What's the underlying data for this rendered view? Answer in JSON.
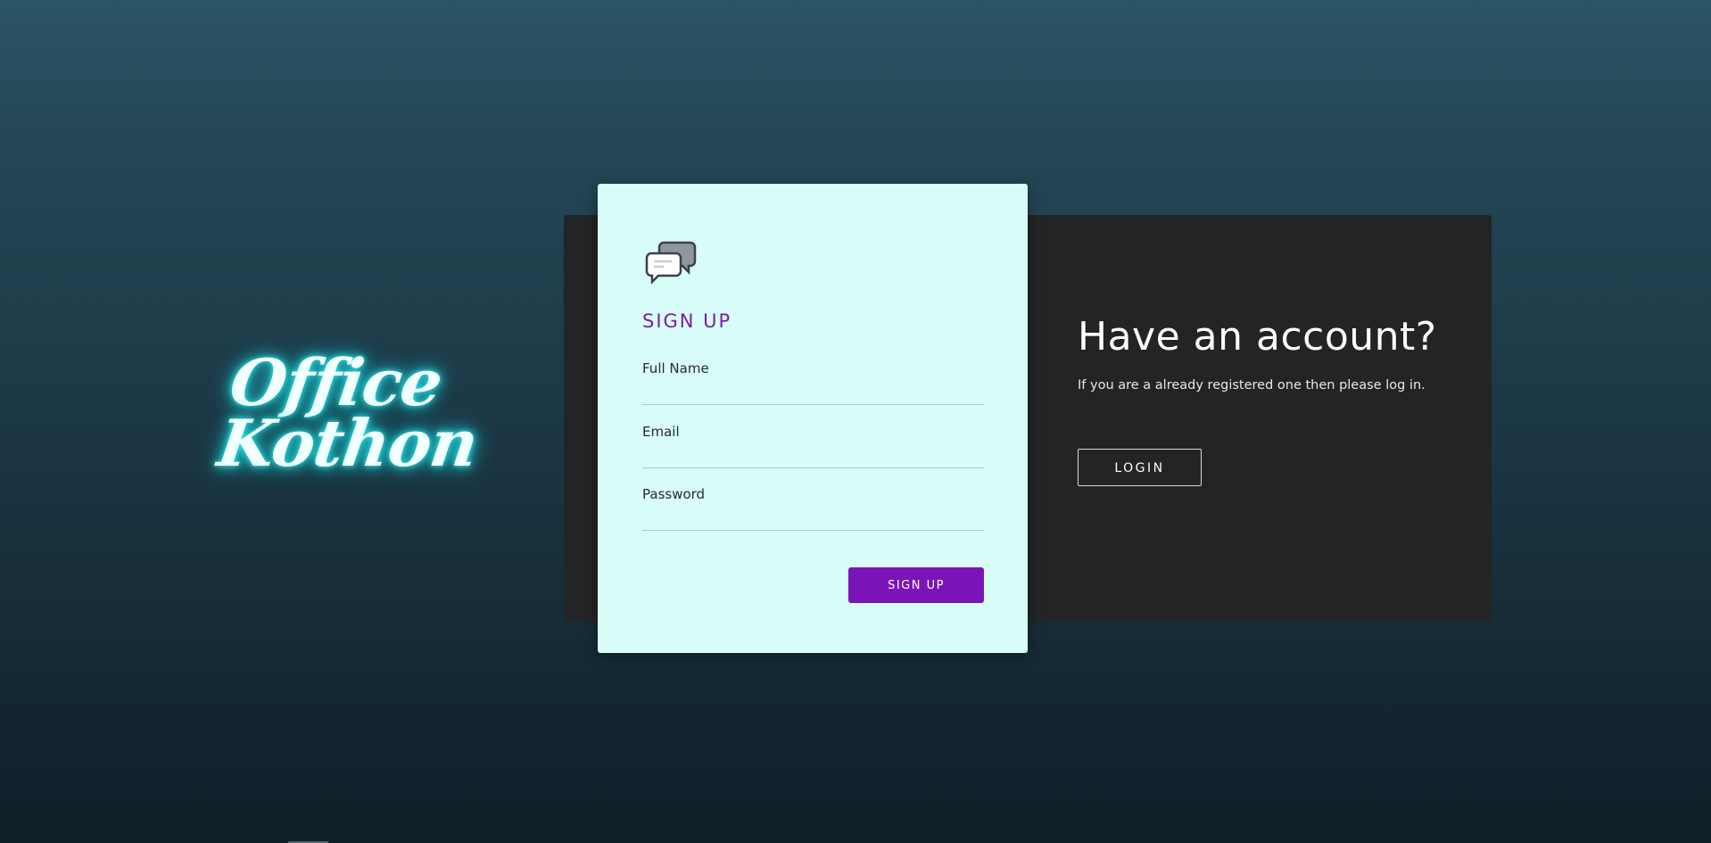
{
  "brand": {
    "line1": "Office",
    "line2": "Kothon"
  },
  "signup_card": {
    "icon": "chat-bubbles-icon",
    "title": "SIGN UP",
    "fields": {
      "full_name": {
        "label": "Full Name",
        "value": "",
        "placeholder": ""
      },
      "email": {
        "label": "Email",
        "value": "",
        "placeholder": ""
      },
      "password": {
        "label": "Password",
        "value": "",
        "placeholder": ""
      }
    },
    "submit_label": "SIGN UP"
  },
  "account_panel": {
    "title": "Have an account?",
    "text": "If you are a already registered one then please log in.",
    "login_label": "LOGIN"
  },
  "colors": {
    "accent_purple": "#7b14b8",
    "card_background": "#d8fcf7",
    "panel_background": "#222426",
    "logo_glow": "#1fd3d8"
  }
}
